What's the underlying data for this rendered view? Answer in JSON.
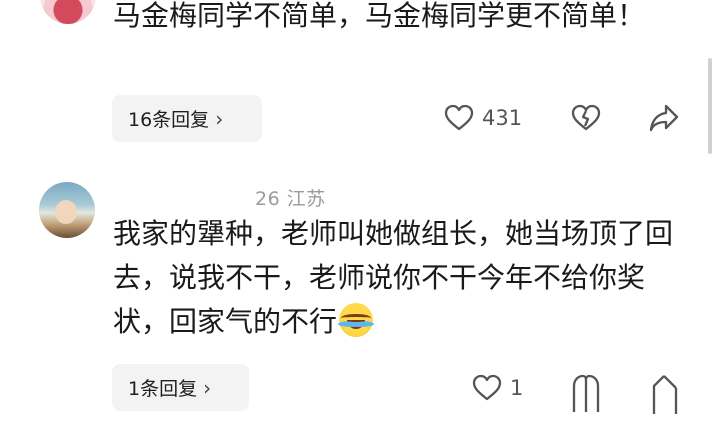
{
  "comments": [
    {
      "text": "马金梅同学不简单，马金梅同学更不简单！",
      "replies_label": "16条回复",
      "likes": "431"
    },
    {
      "meta": "26  江苏",
      "text": "我家的犟种，老师叫她做组长，她当场顶了回去，说我不干，老师说你不干今年不给你奖状，回家气的不行",
      "emoji": "laughing-crying-emoji",
      "replies_label": "1条回复",
      "likes": "1"
    }
  ],
  "icons": {
    "like": "heart-icon",
    "dislike": "broken-heart-icon",
    "share": "share-arrow-icon",
    "more": "chevron-right-icon"
  },
  "colors": {
    "text": "#1a1a1a",
    "meta": "#9b9b9b",
    "reply_bg": "#f3f3f3"
  }
}
